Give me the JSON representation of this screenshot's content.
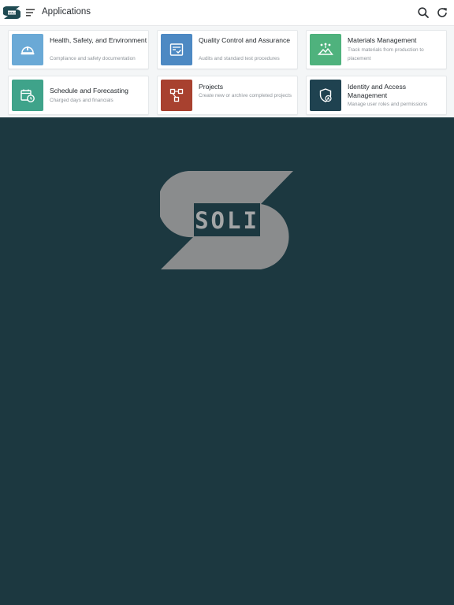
{
  "header": {
    "title": "Applications",
    "logo_text": "SOLI"
  },
  "apps": [
    {
      "title": "Health, Safety, and Environment",
      "description": "Compliance and safety documentation",
      "icon": "hard-hat-icon",
      "color": "#6aa9d6"
    },
    {
      "title": "Quality Control and Assurance",
      "description": "Audits and standard test procedures",
      "icon": "checklist-icon",
      "color": "#4d89c3"
    },
    {
      "title": "Materials Management",
      "description": "Track materials from production to placement",
      "icon": "terrain-icon",
      "color": "#4fb27d"
    },
    {
      "title": "Schedule and Forecasting",
      "description": "Charged days and financials",
      "icon": "calendar-clock-icon",
      "color": "#3fa38a"
    },
    {
      "title": "Projects",
      "description": "Create new or archive completed projects",
      "icon": "workflow-icon",
      "color": "#a8412f"
    },
    {
      "title": "Identity and Access Management",
      "description": "Manage user roles and permissions",
      "icon": "shield-user-icon",
      "color": "#1f4250"
    }
  ],
  "splash": {
    "logo_text": "SOLI"
  },
  "colors": {
    "background": "#1c3840",
    "logo_gray": "#8a8c8d"
  }
}
